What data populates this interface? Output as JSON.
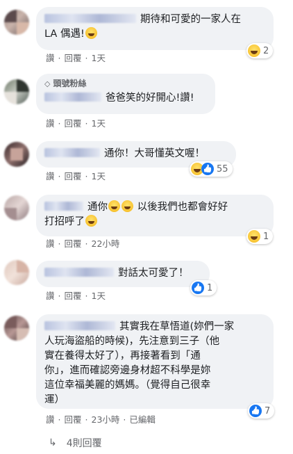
{
  "comments": [
    {
      "text": "期待和可愛的一家人在LA 偶遇!",
      "text_line1": "期待和可愛的一家人在",
      "text_line2": "LA 偶遇!",
      "reaction_count": "2",
      "reaction_type": "haha-icon",
      "like_label": "讚",
      "reply_label": "回覆",
      "time": "1天"
    },
    {
      "badge": "頭號粉絲",
      "badge_icon": "diamond-icon",
      "text": "爸爸笑的好開心!讚!",
      "like_label": "讚",
      "reply_label": "回覆",
      "time": "1天"
    },
    {
      "text": "通你！大哥懂英文喔！",
      "reaction_count": "55",
      "reaction_types": [
        "haha-icon",
        "like-icon"
      ],
      "like_label": "讚",
      "reply_label": "回覆",
      "time": "1天"
    },
    {
      "text_line1a": "通你",
      "text_line1b": " 以後我們也都會好好",
      "text_line2": "打招呼了",
      "reaction_count": "1",
      "reaction_type": "haha-icon",
      "like_label": "讚",
      "reply_label": "回覆",
      "time": "22小時"
    },
    {
      "text": "對話太可愛了！",
      "reaction_count": "1",
      "reaction_type": "like-icon",
      "like_label": "讚",
      "reply_label": "回覆",
      "time": "1天"
    },
    {
      "text_line1": "其實我在草悟道(妳們一家",
      "text_line2": "人玩海盜船的時候)，先注意到三子（他",
      "text_line3": "實在養得太好了），再接著看到「通",
      "text_line4": "你」，進而確認旁邊身材超不科學是妳",
      "text_line5": "這位幸福美麗的媽媽。（覺得自己很幸",
      "text_line6": "運）",
      "reaction_count": "7",
      "reaction_type": "like-icon",
      "like_label": "讚",
      "reply_label": "回覆",
      "time": "23小時",
      "edited_label": "已編輯"
    }
  ],
  "view_replies": {
    "label": "4則回覆",
    "icon": "reply-arrow-icon"
  },
  "colors": {
    "bubble_bg": "#f0f2f5",
    "meta_text": "#65676b",
    "like_blue": "#1877f2",
    "haha_yellow": "#f7c230"
  }
}
